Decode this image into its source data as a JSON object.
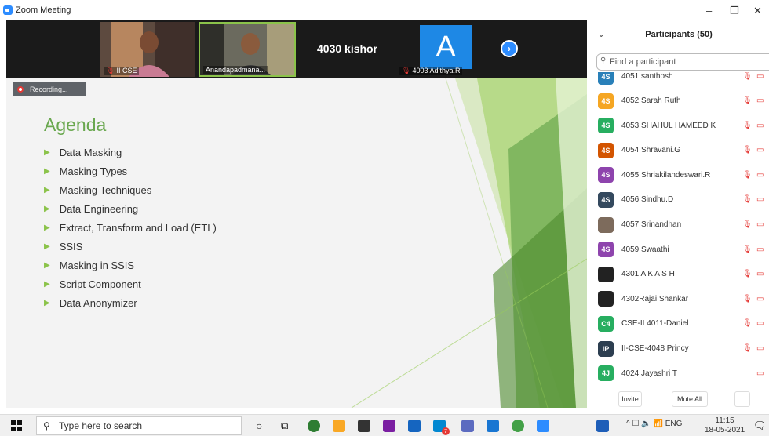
{
  "window": {
    "title": "Zoom Meeting"
  },
  "videos": {
    "tile1_name": "II CSE",
    "tile2_name": "Anandapadmana...",
    "tile3_name": "4030 kishor",
    "tile4_name": "4003 Adithya.R",
    "tile4_letter": "A"
  },
  "recording": {
    "label": "Recording..."
  },
  "slide": {
    "title": "Agenda",
    "items": [
      "Data Masking",
      "Masking Types",
      "Masking Techniques",
      "Data Engineering",
      "Extract, Transform and Load (ETL)",
      "SSIS",
      "Masking in SSIS",
      "Script Component",
      "Data Anonymizer"
    ]
  },
  "participants": {
    "header": "Participants (50)",
    "search_placeholder": "Find a participant",
    "partial_top": "4051 santhosh",
    "list": [
      {
        "initials": "4S",
        "name": "4052 Sarah Ruth",
        "color": "#f5a623"
      },
      {
        "initials": "4S",
        "name": "4053 SHAHUL HAMEED K",
        "color": "#27ae60"
      },
      {
        "initials": "4S",
        "name": "4054 Shravani.G",
        "color": "#d35400"
      },
      {
        "initials": "4S",
        "name": "4055 Shriakilandeswari.R",
        "color": "#8e44ad"
      },
      {
        "initials": "4S",
        "name": "4056 Sindhu.D",
        "color": "#34495e"
      },
      {
        "initials": "",
        "name": "4057 Srinandhan",
        "color": "#7d6b5c"
      },
      {
        "initials": "4S",
        "name": "4059 Swaathi",
        "color": "#8e44ad"
      },
      {
        "initials": "",
        "name": "4301 A K A S H",
        "color": "#222222"
      },
      {
        "initials": "",
        "name": "4302Rajai Shankar",
        "color": "#222222"
      },
      {
        "initials": "C4",
        "name": "CSE-II 4011-Daniel",
        "color": "#27ae60"
      },
      {
        "initials": "IP",
        "name": "II-CSE-4048 Princy",
        "color": "#2c3e50"
      },
      {
        "initials": "4J",
        "name": "4024 Jayashri T",
        "color": "#27ae60"
      }
    ],
    "invite_label": "Invite",
    "mute_all_label": "Mute All",
    "more_label": "..."
  },
  "taskbar": {
    "search_placeholder": "Type here to search",
    "lang": "ENG",
    "time": "11:15",
    "date": "18-05-2021",
    "badge": "7"
  },
  "colors": {
    "accent": "#2d8cff",
    "slide_green": "#6aa84f",
    "muted_red": "#e53935"
  }
}
